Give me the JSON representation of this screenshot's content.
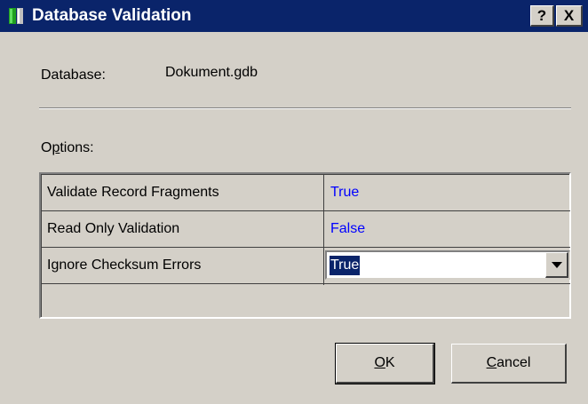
{
  "window": {
    "title": "Database Validation",
    "help_glyph": "?",
    "close_glyph": "X",
    "icon": "database-app-icon"
  },
  "database": {
    "label": "Database:",
    "value": "Dokument.gdb"
  },
  "options": {
    "label_prefix": "O",
    "label_mnemonic": "p",
    "label_rest": "tions:",
    "rows": [
      {
        "name": "Validate Record Fragments",
        "value": "True"
      },
      {
        "name": "Read Only Validation",
        "value": "False"
      },
      {
        "name": "Ignore Checksum Errors",
        "value": "True"
      }
    ]
  },
  "buttons": {
    "ok_mnemonic": "O",
    "ok_rest": "K",
    "cancel_mnemonic": "C",
    "cancel_rest": "ancel"
  },
  "colors": {
    "titlebar": "#0a246a",
    "face": "#d4d0c8",
    "value_text": "#0000ff",
    "selection": "#0a246a"
  }
}
